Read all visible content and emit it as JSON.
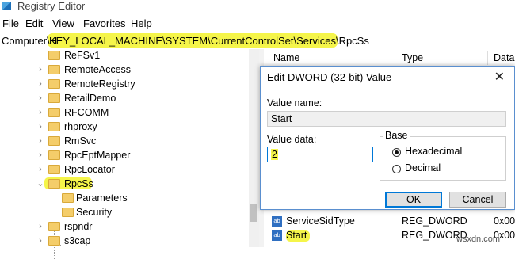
{
  "window": {
    "title": "Registry Editor"
  },
  "menu": [
    "File",
    "Edit",
    "View",
    "Favorites",
    "Help"
  ],
  "address": {
    "prefix": "Computer\\H",
    "path": "KEY_LOCAL_MACHINE\\SYSTEM\\CurrentControlSet\\Services\\RpcSs"
  },
  "tree": {
    "items": [
      "ReFSv1",
      "RemoteAccess",
      "RemoteRegistry",
      "RetailDemo",
      "RFCOMM",
      "rhproxy",
      "RmSvc",
      "RpcEptMapper",
      "RpcLocator",
      "RpcSs",
      "rspndr",
      "s3cap"
    ],
    "subitems": [
      "Parameters",
      "Security"
    ]
  },
  "list": {
    "columns": [
      "Name",
      "Type",
      "Data"
    ],
    "rows": [
      {
        "name": "ServiceSidType",
        "type": "REG_DWORD",
        "data": "0x00"
      },
      {
        "name": "Start",
        "type": "REG_DWORD",
        "data": "0x00"
      }
    ],
    "icon_text": "ab"
  },
  "dialog": {
    "title": "Edit DWORD (32-bit) Value",
    "close_glyph": "✕",
    "value_name_label": "Value name:",
    "value_name": "Start",
    "value_data_label": "Value data:",
    "value_data": "2",
    "base_label": "Base",
    "options": [
      "Hexadecimal",
      "Decimal"
    ],
    "selected_option": "Hexadecimal",
    "ok_label": "OK",
    "cancel_label": "Cancel"
  },
  "watermark": "wsxdn.com",
  "colors": {
    "highlight": "#f5f54a",
    "accent": "#0078d7",
    "folder": "#f4cd6a"
  }
}
